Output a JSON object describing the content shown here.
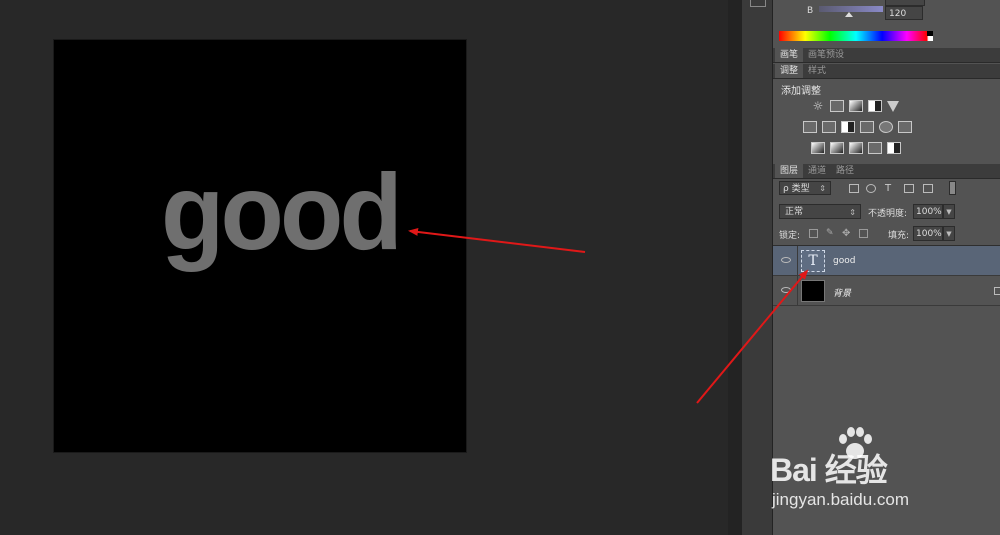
{
  "document": {
    "text_layer_content": "good"
  },
  "color_panel": {
    "channel_label": "B",
    "channel_value": "120"
  },
  "brush_tabs": [
    "画笔",
    "画笔预设"
  ],
  "adjust_tabs": [
    "调整",
    "样式"
  ],
  "adjustments": {
    "title": "添加调整"
  },
  "layers_tabs": [
    "图层",
    "通道",
    "路径"
  ],
  "layers_panel": {
    "filter_label": "ρ 类型",
    "blend_mode": "正常",
    "opacity_label": "不透明度:",
    "opacity_value": "100%",
    "lock_label": "锁定:",
    "fill_label": "填充:",
    "fill_value": "100%",
    "layers": [
      {
        "name": "good",
        "thumb_glyph": "T",
        "selected": true
      },
      {
        "name": "背景",
        "selected": false
      }
    ]
  },
  "watermark": {
    "logo": "Bai  经验",
    "du": "du",
    "url": "jingyan.baidu.com"
  },
  "colors": {
    "canvas_bg": "#000000",
    "text_color": "#6f6f6f",
    "arrow": "#e01818",
    "selected_layer": "#596577"
  }
}
